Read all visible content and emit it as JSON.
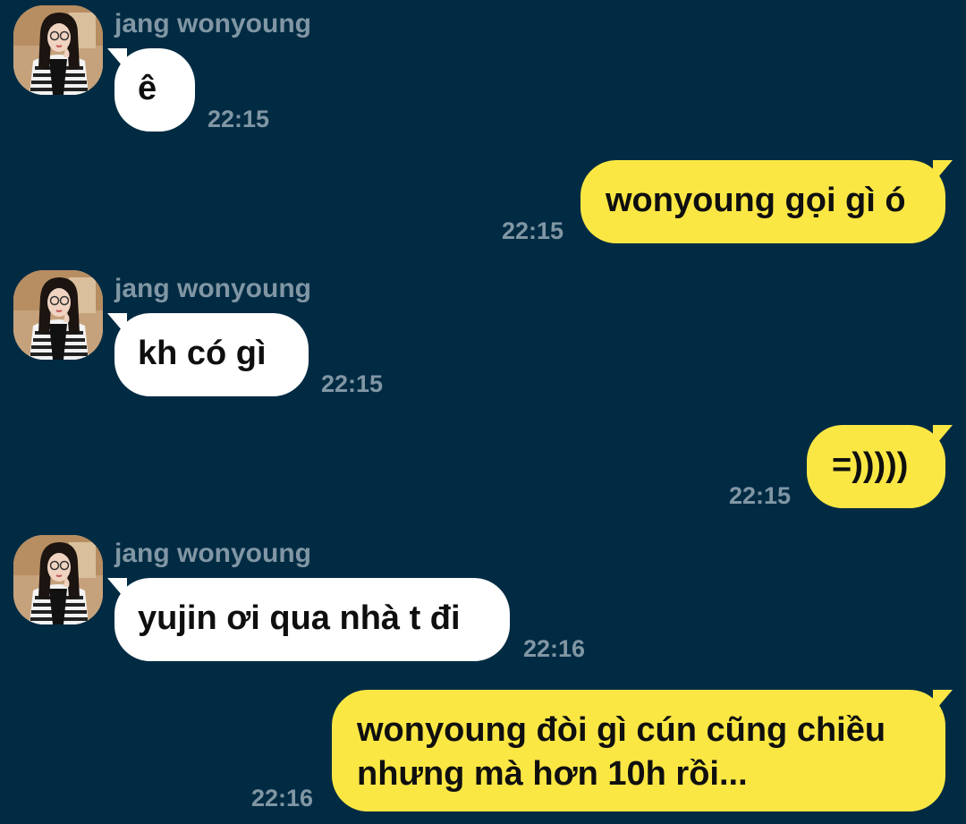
{
  "chat": {
    "contact_name": "jang wonyoung",
    "avatar_icon": "profile-photo-avatar",
    "messages": [
      {
        "direction": "in",
        "sender": "jang wonyoung",
        "text": "ê",
        "time": "22:15"
      },
      {
        "direction": "out",
        "text": "wonyoung gọi gì ó",
        "time": "22:15"
      },
      {
        "direction": "in",
        "sender": "jang wonyoung",
        "text": "kh có gì",
        "time": "22:15"
      },
      {
        "direction": "out",
        "text": "=)))))",
        "time": "22:15"
      },
      {
        "direction": "in",
        "sender": "jang wonyoung",
        "text": "yujin ơi qua nhà t đi",
        "time": "22:16"
      },
      {
        "direction": "out",
        "lines": [
          "wonyoung đòi gì cún cũng chiều",
          "nhưng mà  hơn 10h rồi..."
        ],
        "time": "22:16"
      }
    ]
  },
  "colors": {
    "background": "#002b43",
    "incoming_bubble": "#ffffff",
    "outgoing_bubble": "#fbe744",
    "meta_text": "#8196a4"
  }
}
